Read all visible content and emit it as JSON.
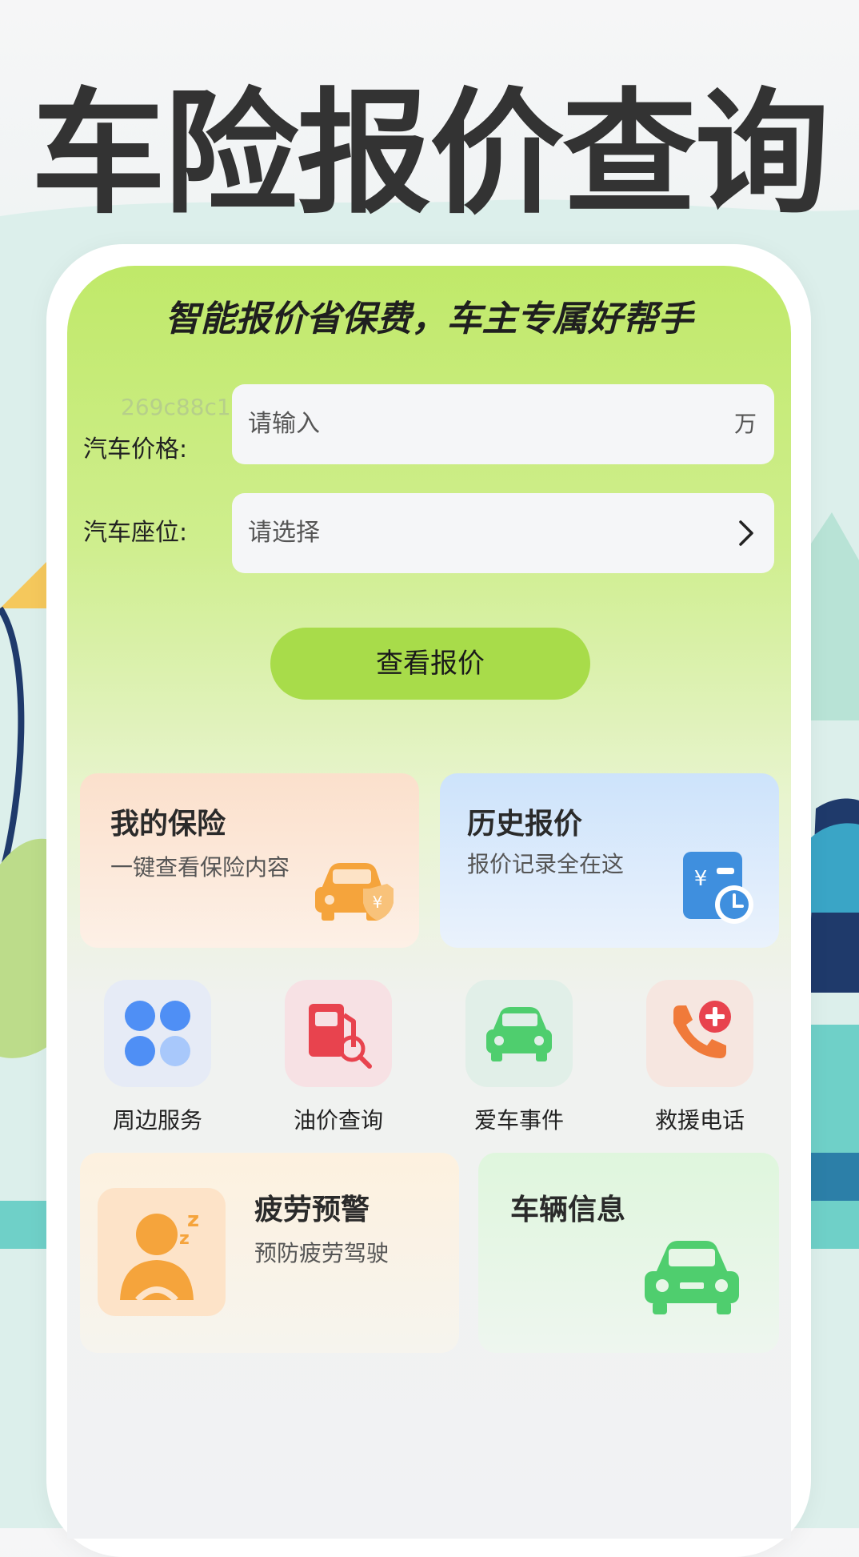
{
  "headline": "车险报价查询",
  "slogan": "智能报价省保费，车主专属好帮手",
  "watermark": "269c88c1",
  "form": {
    "price_label": "汽车价格:",
    "price_placeholder": "请输入",
    "price_unit": "万",
    "seat_label": "汽车座位:",
    "seat_placeholder": "请选择"
  },
  "quote_button": "查看报价",
  "cards": {
    "my_insurance": {
      "title": "我的保险",
      "subtitle": "一键查看保险内容"
    },
    "history": {
      "title": "历史报价",
      "subtitle": "报价记录全在这"
    },
    "fatigue": {
      "title": "疲劳预警",
      "subtitle": "预防疲劳驾驶"
    },
    "vehicle": {
      "title": "车辆信息"
    }
  },
  "services": [
    {
      "label": "周边服务",
      "icon": "grid-icon"
    },
    {
      "label": "油价查询",
      "icon": "fuel-search-icon"
    },
    {
      "label": "爱车事件",
      "icon": "car-icon"
    },
    {
      "label": "救援电话",
      "icon": "phone-plus-icon"
    }
  ],
  "colors": {
    "accent": "#a8dc4a",
    "header_green": "#c0e969",
    "orange": "#f5a43c",
    "blue": "#3f8fde",
    "green": "#4fce6e",
    "red": "#e8434e"
  }
}
